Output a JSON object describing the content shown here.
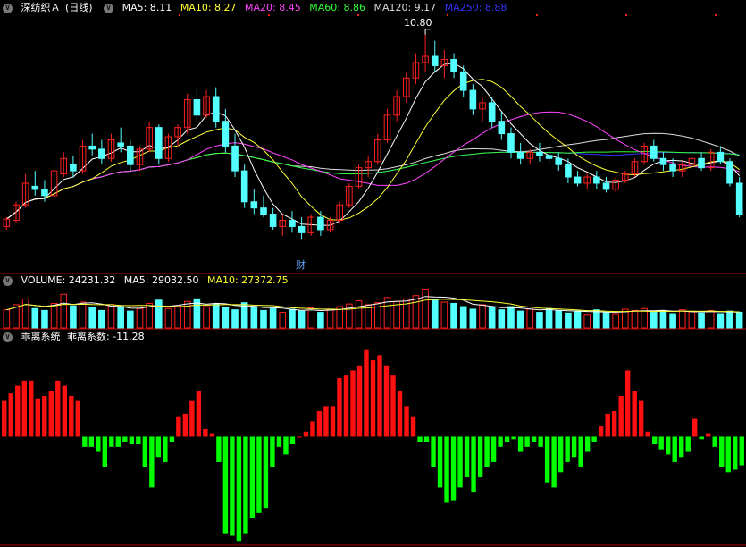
{
  "price_panel": {
    "name": "深纺织Ａ",
    "period": "(日线)",
    "ma": [
      {
        "label": "MA5: 8.11",
        "color": "#ffffff"
      },
      {
        "label": "MA10: 8.27",
        "color": "#ffff33"
      },
      {
        "label": "MA20: 8.45",
        "color": "#ff44ff"
      },
      {
        "label": "MA60: 8.86",
        "color": "#33ff33"
      },
      {
        "label": "MA120: 9.17",
        "color": "#dddddd"
      },
      {
        "label": "MA250: 8.88",
        "color": "#3333ff"
      }
    ],
    "high_marker": "10.80",
    "event_badge": "财"
  },
  "volume_panel": {
    "title": "VOLUME: 24231.32",
    "ma5": "MA5: 29032.50",
    "ma10": "MA10: 27372.75"
  },
  "bias_panel": {
    "title": "乖离系统",
    "value": "乖离系数: -11.28"
  },
  "colors": {
    "up": "#ff2020",
    "down": "#54ffff",
    "bias_up": "#ff1010",
    "bias_down": "#00ff00",
    "divider": "#b00000"
  },
  "chart_data": [
    {
      "type": "candlestick",
      "title": "深纺织Ａ (日线)",
      "ylim": [
        7.1,
        11.1
      ],
      "candles": [
        [
          7.7,
          7.85,
          7.65,
          7.82
        ],
        [
          7.8,
          8.1,
          7.75,
          8.05
        ],
        [
          8.05,
          8.55,
          8.0,
          8.4
        ],
        [
          8.35,
          8.6,
          8.2,
          8.3
        ],
        [
          8.3,
          8.45,
          8.1,
          8.2
        ],
        [
          8.2,
          8.7,
          8.15,
          8.6
        ],
        [
          8.55,
          8.9,
          8.5,
          8.8
        ],
        [
          8.7,
          8.85,
          8.5,
          8.6
        ],
        [
          8.6,
          9.1,
          8.55,
          9.0
        ],
        [
          9.0,
          9.2,
          8.85,
          8.95
        ],
        [
          8.95,
          9.1,
          8.7,
          8.8
        ],
        [
          8.8,
          9.2,
          8.75,
          9.1
        ],
        [
          9.05,
          9.3,
          8.9,
          9.0
        ],
        [
          9.0,
          9.1,
          8.6,
          8.7
        ],
        [
          8.7,
          9.0,
          8.6,
          8.95
        ],
        [
          8.95,
          9.4,
          8.9,
          9.3
        ],
        [
          9.3,
          9.35,
          8.7,
          8.8
        ],
        [
          8.8,
          9.2,
          8.75,
          9.15
        ],
        [
          9.15,
          9.35,
          9.0,
          9.3
        ],
        [
          9.3,
          9.85,
          9.2,
          9.75
        ],
        [
          9.75,
          9.95,
          9.4,
          9.5
        ],
        [
          9.5,
          9.9,
          9.45,
          9.8
        ],
        [
          9.8,
          9.95,
          9.3,
          9.4
        ],
        [
          9.4,
          9.6,
          8.9,
          9.0
        ],
        [
          9.0,
          9.2,
          8.5,
          8.6
        ],
        [
          8.6,
          8.7,
          8.0,
          8.1
        ],
        [
          8.1,
          8.3,
          7.9,
          8.0
        ],
        [
          8.0,
          8.2,
          7.85,
          7.9
        ],
        [
          7.9,
          8.0,
          7.65,
          7.7
        ],
        [
          7.7,
          7.9,
          7.55,
          7.8
        ],
        [
          7.8,
          7.95,
          7.6,
          7.7
        ],
        [
          7.7,
          7.85,
          7.5,
          7.6
        ],
        [
          7.6,
          7.9,
          7.55,
          7.85
        ],
        [
          7.85,
          7.95,
          7.55,
          7.65
        ],
        [
          7.65,
          7.85,
          7.6,
          7.8
        ],
        [
          7.8,
          8.1,
          7.75,
          8.05
        ],
        [
          8.05,
          8.4,
          8.0,
          8.35
        ],
        [
          8.35,
          8.7,
          8.3,
          8.65
        ],
        [
          8.65,
          8.85,
          8.5,
          8.75
        ],
        [
          8.75,
          9.2,
          8.7,
          9.1
        ],
        [
          9.1,
          9.6,
          9.05,
          9.5
        ],
        [
          9.5,
          9.9,
          9.4,
          9.8
        ],
        [
          9.8,
          10.2,
          9.7,
          10.1
        ],
        [
          10.1,
          10.5,
          10.0,
          10.35
        ],
        [
          10.35,
          10.8,
          10.2,
          10.45
        ],
        [
          10.45,
          10.7,
          10.2,
          10.3
        ],
        [
          10.3,
          10.55,
          10.1,
          10.4
        ],
        [
          10.4,
          10.5,
          10.1,
          10.2
        ],
        [
          10.2,
          10.3,
          9.8,
          9.9
        ],
        [
          9.9,
          10.0,
          9.5,
          9.6
        ],
        [
          9.6,
          9.8,
          9.4,
          9.7
        ],
        [
          9.7,
          9.8,
          9.3,
          9.4
        ],
        [
          9.4,
          9.55,
          9.1,
          9.2
        ],
        [
          9.2,
          9.3,
          8.8,
          8.9
        ],
        [
          8.9,
          9.05,
          8.7,
          8.8
        ],
        [
          8.8,
          8.95,
          8.7,
          8.9
        ],
        [
          8.9,
          9.05,
          8.75,
          8.85
        ],
        [
          8.85,
          9.0,
          8.7,
          8.8
        ],
        [
          8.8,
          8.9,
          8.6,
          8.7
        ],
        [
          8.7,
          8.8,
          8.4,
          8.5
        ],
        [
          8.5,
          8.6,
          8.35,
          8.4
        ],
        [
          8.4,
          8.55,
          8.3,
          8.5
        ],
        [
          8.5,
          8.6,
          8.3,
          8.4
        ],
        [
          8.4,
          8.5,
          8.25,
          8.3
        ],
        [
          8.3,
          8.5,
          8.25,
          8.45
        ],
        [
          8.45,
          8.6,
          8.4,
          8.55
        ],
        [
          8.55,
          8.8,
          8.5,
          8.75
        ],
        [
          8.75,
          9.05,
          8.7,
          9.0
        ],
        [
          9.0,
          9.1,
          8.75,
          8.8
        ],
        [
          8.8,
          8.9,
          8.6,
          8.7
        ],
        [
          8.7,
          8.8,
          8.5,
          8.6
        ],
        [
          8.6,
          8.75,
          8.5,
          8.7
        ],
        [
          8.7,
          8.85,
          8.6,
          8.8
        ],
        [
          8.8,
          8.9,
          8.6,
          8.65
        ],
        [
          8.65,
          8.95,
          8.6,
          8.9
        ],
        [
          8.9,
          9.0,
          8.7,
          8.75
        ],
        [
          8.75,
          8.8,
          8.35,
          8.4
        ],
        [
          8.4,
          8.5,
          7.85,
          7.9
        ]
      ]
    },
    {
      "type": "bar",
      "title": "VOLUME: 24231.32",
      "ylim": [
        0,
        62000
      ],
      "values": [
        28000,
        36000,
        45000,
        30000,
        27000,
        38000,
        52000,
        34000,
        40000,
        31000,
        27000,
        36000,
        33000,
        26000,
        30000,
        38000,
        43000,
        30000,
        34000,
        41000,
        45000,
        33000,
        37000,
        31000,
        28000,
        39000,
        33000,
        27000,
        30000,
        24000,
        29000,
        26000,
        31000,
        24000,
        28000,
        33000,
        37000,
        42000,
        36000,
        39000,
        47000,
        41000,
        45000,
        50000,
        60000,
        43000,
        40000,
        38000,
        33000,
        29000,
        36000,
        31000,
        28000,
        33000,
        26000,
        29000,
        24000,
        30000,
        27000,
        23000,
        26000,
        21000,
        28000,
        24000,
        22000,
        29000,
        27000,
        30000,
        24000,
        26000,
        22000,
        28000,
        25000,
        23000,
        27000,
        22000,
        26000,
        24231
      ],
      "colors_up_down": true
    },
    {
      "type": "bar",
      "title": "乖离系统",
      "ylim": [
        -42,
        36
      ],
      "values": [
        14,
        17,
        20,
        22,
        22,
        15,
        16,
        18,
        22,
        20,
        16,
        14,
        -4,
        -4,
        -6,
        -12,
        -4,
        -4,
        -2,
        -3,
        -3,
        -12,
        -20,
        -8,
        -10,
        -2,
        8,
        9,
        14,
        18,
        3,
        1,
        -10,
        -38,
        -39,
        -41,
        -38,
        -32,
        -30,
        -28,
        -12,
        -4,
        -7,
        -3,
        0,
        2,
        6,
        10,
        12,
        12,
        23,
        24,
        26,
        28,
        34,
        30,
        32,
        28,
        24,
        18,
        12,
        8,
        -2,
        -2,
        -12,
        -20,
        -26,
        -25,
        -20,
        -16,
        -22,
        -16,
        -12,
        -10,
        -4,
        -2,
        -1,
        -6,
        -4,
        -2,
        -4,
        -18,
        -20,
        -14,
        -10,
        -8,
        -12,
        -6,
        -2,
        4,
        9,
        10,
        16,
        26,
        18,
        14,
        2,
        -3,
        -5,
        -7,
        -10,
        -8,
        -6,
        7,
        -1,
        1,
        -4,
        -12,
        -14,
        -13,
        -11.28
      ]
    }
  ]
}
